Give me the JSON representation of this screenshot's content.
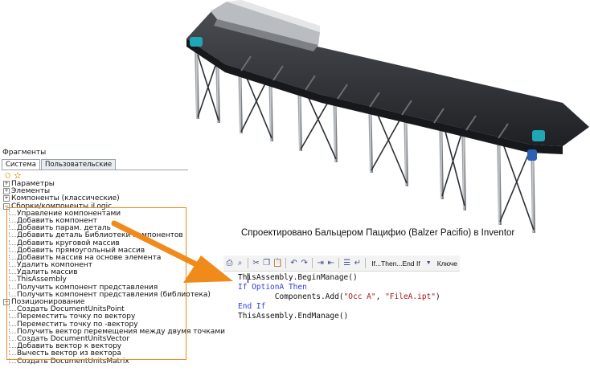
{
  "caption": "Спроектировано Бальцером Пацифио (Balzer Pacifio) в Inventor",
  "accent_color": "#f08a1a",
  "snippets": {
    "title": "Фрагменты",
    "tabs": [
      "Система",
      "Пользовательские"
    ],
    "toolbar_icons": [
      "star-icon",
      "star-add-icon"
    ],
    "tree": [
      {
        "label": "Параметры",
        "expander": "+",
        "level": 0
      },
      {
        "label": "Элементы",
        "expander": "+",
        "level": 0
      },
      {
        "label": "Компоненты (классические)",
        "expander": "+",
        "level": 0
      },
      {
        "label": "Сборки/компоненты iLogic",
        "expander": "−",
        "level": 0
      },
      {
        "label": "Управление компонентами",
        "level": 1
      },
      {
        "label": "Добавить компонент",
        "level": 1
      },
      {
        "label": "Добавить парам. деталь",
        "level": 1
      },
      {
        "label": "Добавить деталь Библиотеки компонентов",
        "level": 1
      },
      {
        "label": "Добавить круговой массив",
        "level": 1
      },
      {
        "label": "Добавить прямоугольный массив",
        "level": 1
      },
      {
        "label": "Добавить массив на основе элемента",
        "level": 1
      },
      {
        "label": "Удалить компонент",
        "level": 1
      },
      {
        "label": "Удалить массив",
        "level": 1
      },
      {
        "label": "ThisAssembly",
        "level": 1
      },
      {
        "label": "Получить компонент представления",
        "level": 1
      },
      {
        "label": "Получить компонент представления (библиотека)",
        "level": 1
      },
      {
        "label": "Позиционирование",
        "expander": "−",
        "level": 0
      },
      {
        "label": "Создать DocumentUnitsPoint",
        "level": 1
      },
      {
        "label": "Переместить точку по вектору",
        "level": 1
      },
      {
        "label": "Переместить точку по -вектору",
        "level": 1
      },
      {
        "label": "Получить вектор перемещения между двумя точками",
        "level": 1
      },
      {
        "label": "Создать DocumentUnitsVector",
        "level": 1
      },
      {
        "label": "Добавить вектор к вектору",
        "level": 1
      },
      {
        "label": "Вычесть вектор из вектора",
        "level": 1
      },
      {
        "label": "Создать DocumentUnitsMatrix",
        "level": 1
      }
    ]
  },
  "editor": {
    "toolbar_icons": [
      "print-icon",
      "print-preview-icon",
      "cut-icon",
      "copy-icon",
      "paste-icon",
      "undo-icon",
      "redo-icon",
      "indent-icon",
      "outdent-icon",
      "comment-icon",
      "uncomment-icon",
      "wrap-icon"
    ],
    "keyword_combo": "If...Then...End If",
    "keywords_label": "Ключе",
    "code_lines": [
      [
        {
          "t": "ThisAssembly.BeginManage()",
          "c": "plain"
        }
      ],
      [
        {
          "t": "If ",
          "c": "kw"
        },
        {
          "t": "OptionA ",
          "c": "kw"
        },
        {
          "t": "Then",
          "c": "kw"
        }
      ],
      [
        {
          "t": "        Components.Add(",
          "c": "plain"
        },
        {
          "t": "\"Occ A\"",
          "c": "str"
        },
        {
          "t": ", ",
          "c": "plain"
        },
        {
          "t": "\"FileA.ipt\"",
          "c": "str"
        },
        {
          "t": ")",
          "c": "plain"
        }
      ],
      [
        {
          "t": "End If",
          "c": "kw"
        }
      ],
      [
        {
          "t": "ThisAssembly.EndManage()",
          "c": "plain"
        }
      ]
    ]
  }
}
